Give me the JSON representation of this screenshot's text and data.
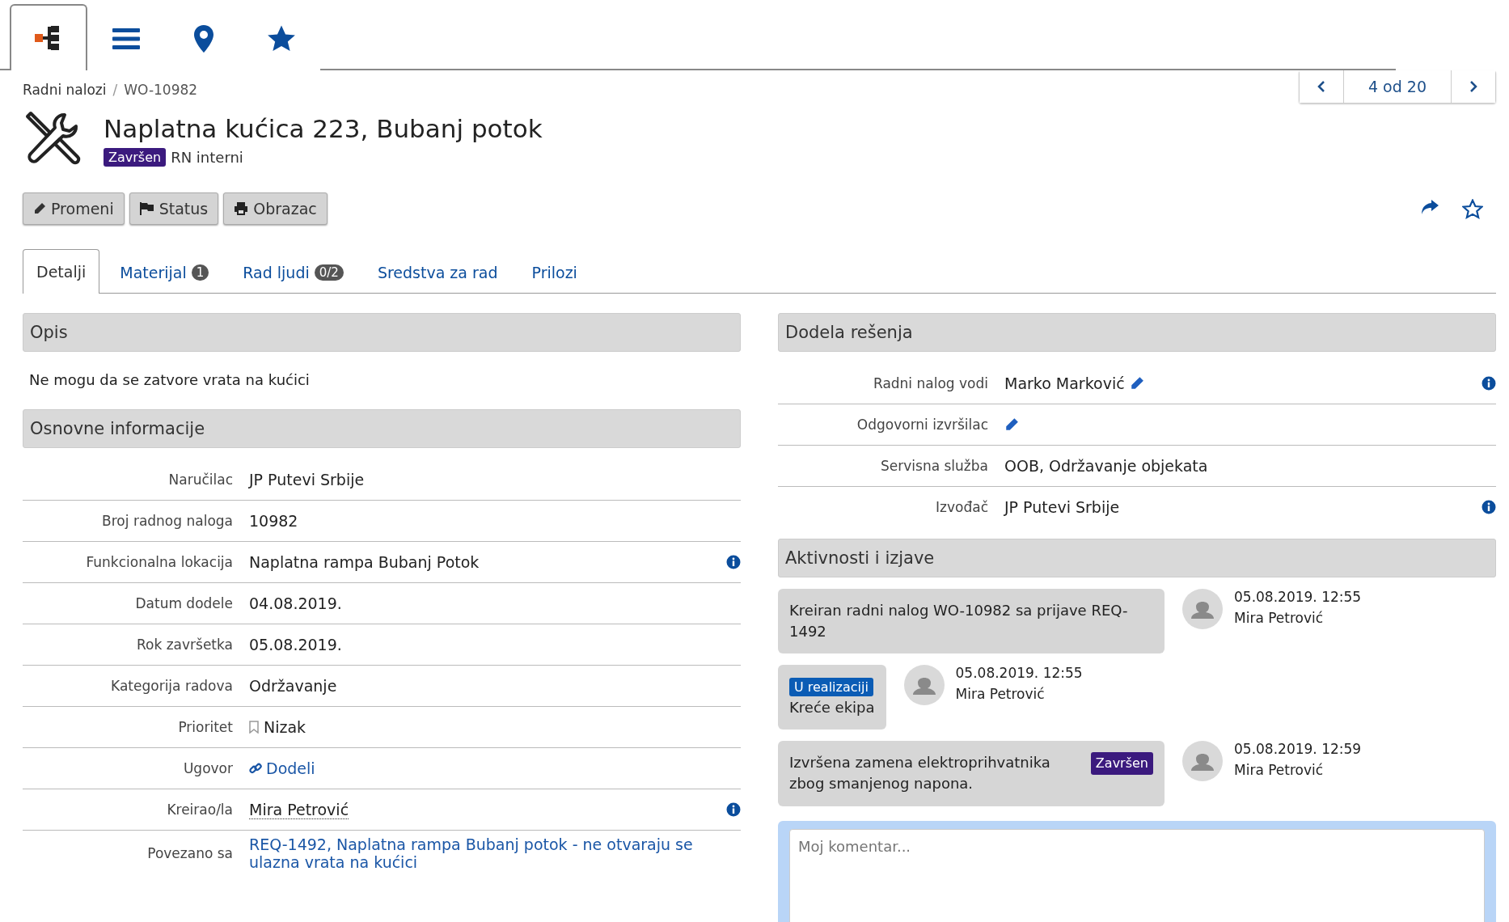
{
  "nav_tabs": [
    {
      "kind": "hierarchy",
      "selected": true
    },
    {
      "kind": "list",
      "selected": false
    },
    {
      "kind": "pin",
      "selected": false
    },
    {
      "kind": "star",
      "selected": false
    }
  ],
  "breadcrumb": {
    "parent": "Radni nalozi",
    "separator": "/",
    "current": "WO-10982"
  },
  "pager": {
    "label": "4 od 20"
  },
  "header": {
    "title": "Naplatna kućica 223, Bubanj potok",
    "status": {
      "label": "Završen",
      "color": "#3b1a7e"
    },
    "type": "RN interni"
  },
  "actions": [
    {
      "kind": "pencil",
      "label": "Promeni"
    },
    {
      "kind": "flag",
      "label": "Status"
    },
    {
      "kind": "print",
      "label": "Obrazac"
    }
  ],
  "tabs": [
    {
      "label": "Detalji",
      "selected": true
    },
    {
      "label": "Materijal",
      "count": "1",
      "selected": false
    },
    {
      "label": "Rad ljudi",
      "count": "0/2",
      "selected": false
    },
    {
      "label": "Sredstva za rad",
      "selected": false
    },
    {
      "label": "Prilozi",
      "selected": false
    }
  ],
  "opis": {
    "title": "Opis",
    "text": "Ne mogu da se zatvore vrata na kućici"
  },
  "osnovne": {
    "title": "Osnovne informacije",
    "rows": [
      {
        "label": "Naručilac",
        "value": "JP Putevi Srbije",
        "kind": "text",
        "info": false
      },
      {
        "label": "Broj radnog naloga",
        "value": "10982",
        "kind": "text",
        "info": false
      },
      {
        "label": "Funkcionalna lokacija",
        "value": "Naplatna rampa Bubanj Potok",
        "kind": "text",
        "info": true
      },
      {
        "label": "Datum dodele",
        "value": "04.08.2019.",
        "kind": "text",
        "info": false
      },
      {
        "label": "Rok završetka",
        "value": "05.08.2019.",
        "kind": "text",
        "info": false
      },
      {
        "label": "Kategorija radova",
        "value": "Održavanje",
        "kind": "text",
        "info": false
      },
      {
        "label": "Prioritet",
        "value": "Nizak",
        "kind": "priority",
        "info": false
      },
      {
        "label": "Ugovor",
        "value": "Dodeli",
        "kind": "assign",
        "info": false
      },
      {
        "label": "Kreirao/la",
        "value": "Mira Petrović",
        "kind": "user",
        "info": true
      },
      {
        "label": "Povezano sa",
        "value": "REQ-1492, Naplatna rampa Bubanj potok - ne otvaraju se ulazna vrata na kućici",
        "kind": "link",
        "info": false
      }
    ]
  },
  "dodela": {
    "title": "Dodela rešenja",
    "rows": [
      {
        "label": "Radni nalog vodi",
        "value": "Marko Marković",
        "edit": true,
        "info": true
      },
      {
        "label": "Odgovorni izvršilac",
        "edit": true,
        "info": false
      },
      {
        "label": "Servisna služba",
        "value": "OOB, Održavanje objekata",
        "edit": false,
        "info": false
      },
      {
        "label": "Izvođač",
        "value": "JP Putevi Srbije",
        "edit": false,
        "info": true
      }
    ]
  },
  "aktivnosti": {
    "title": "Aktivnosti i izjave",
    "items": [
      {
        "kind": "note",
        "text": "Kreiran radni nalog WO-10982 sa prijave REQ-1492",
        "time": "05.08.2019. 12:55",
        "author": "Mira Petrović"
      },
      {
        "kind": "status",
        "status": {
          "label": "U realizaciji",
          "color": "#0b5cb5"
        },
        "text": "Kreće ekipa",
        "time": "05.08.2019. 12:55",
        "author": "Mira Petrović"
      },
      {
        "kind": "note_status",
        "status": {
          "label": "Završen",
          "color": "#3b1a7e"
        },
        "text": "Izvršena zamena elektroprihvatnika zbog smanjenog napona.",
        "time": "05.08.2019. 12:59",
        "author": "Mira Petrović"
      }
    ]
  },
  "comment": {
    "placeholder": "Moj komentar..."
  }
}
